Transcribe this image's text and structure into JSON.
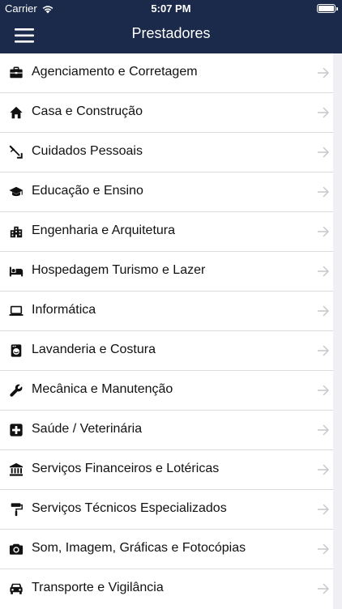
{
  "status_bar": {
    "carrier": "Carrier",
    "time": "5:07 PM",
    "battery_level": 1.0
  },
  "nav_bar": {
    "title": "Prestadores",
    "menu_icon": "hamburger-menu-icon"
  },
  "colors": {
    "header_background": "#1b2a4a",
    "list_background": "#ffffff",
    "page_background": "#efeff4",
    "text": "#111111",
    "chevron": "#c7c7cc"
  },
  "categories": [
    {
      "label": "Agenciamento e Corretagem",
      "icon": "briefcase-icon"
    },
    {
      "label": "Casa e Construção",
      "icon": "home-icon"
    },
    {
      "label": "Cuidados Pessoais",
      "icon": "personal-care-icon"
    },
    {
      "label": "Educação e Ensino",
      "icon": "graduation-cap-icon"
    },
    {
      "label": "Engenharia e Arquitetura",
      "icon": "building-icon"
    },
    {
      "label": "Hospedagem Turismo e Lazer",
      "icon": "bed-icon"
    },
    {
      "label": "Informática",
      "icon": "laptop-icon"
    },
    {
      "label": "Lavanderia e Costura",
      "icon": "washing-machine-icon"
    },
    {
      "label": "Mecânica e Manutenção",
      "icon": "wrench-icon"
    },
    {
      "label": "Saúde / Veterinária",
      "icon": "medical-cross-icon"
    },
    {
      "label": "Serviços Financeiros e Lotéricas",
      "icon": "bank-icon"
    },
    {
      "label": "Serviços Técnicos Especializados",
      "icon": "paint-roller-icon"
    },
    {
      "label": "Som, Imagem, Gráficas e Fotocópias",
      "icon": "camera-icon"
    },
    {
      "label": "Transporte e Vigilância",
      "icon": "car-icon"
    }
  ]
}
